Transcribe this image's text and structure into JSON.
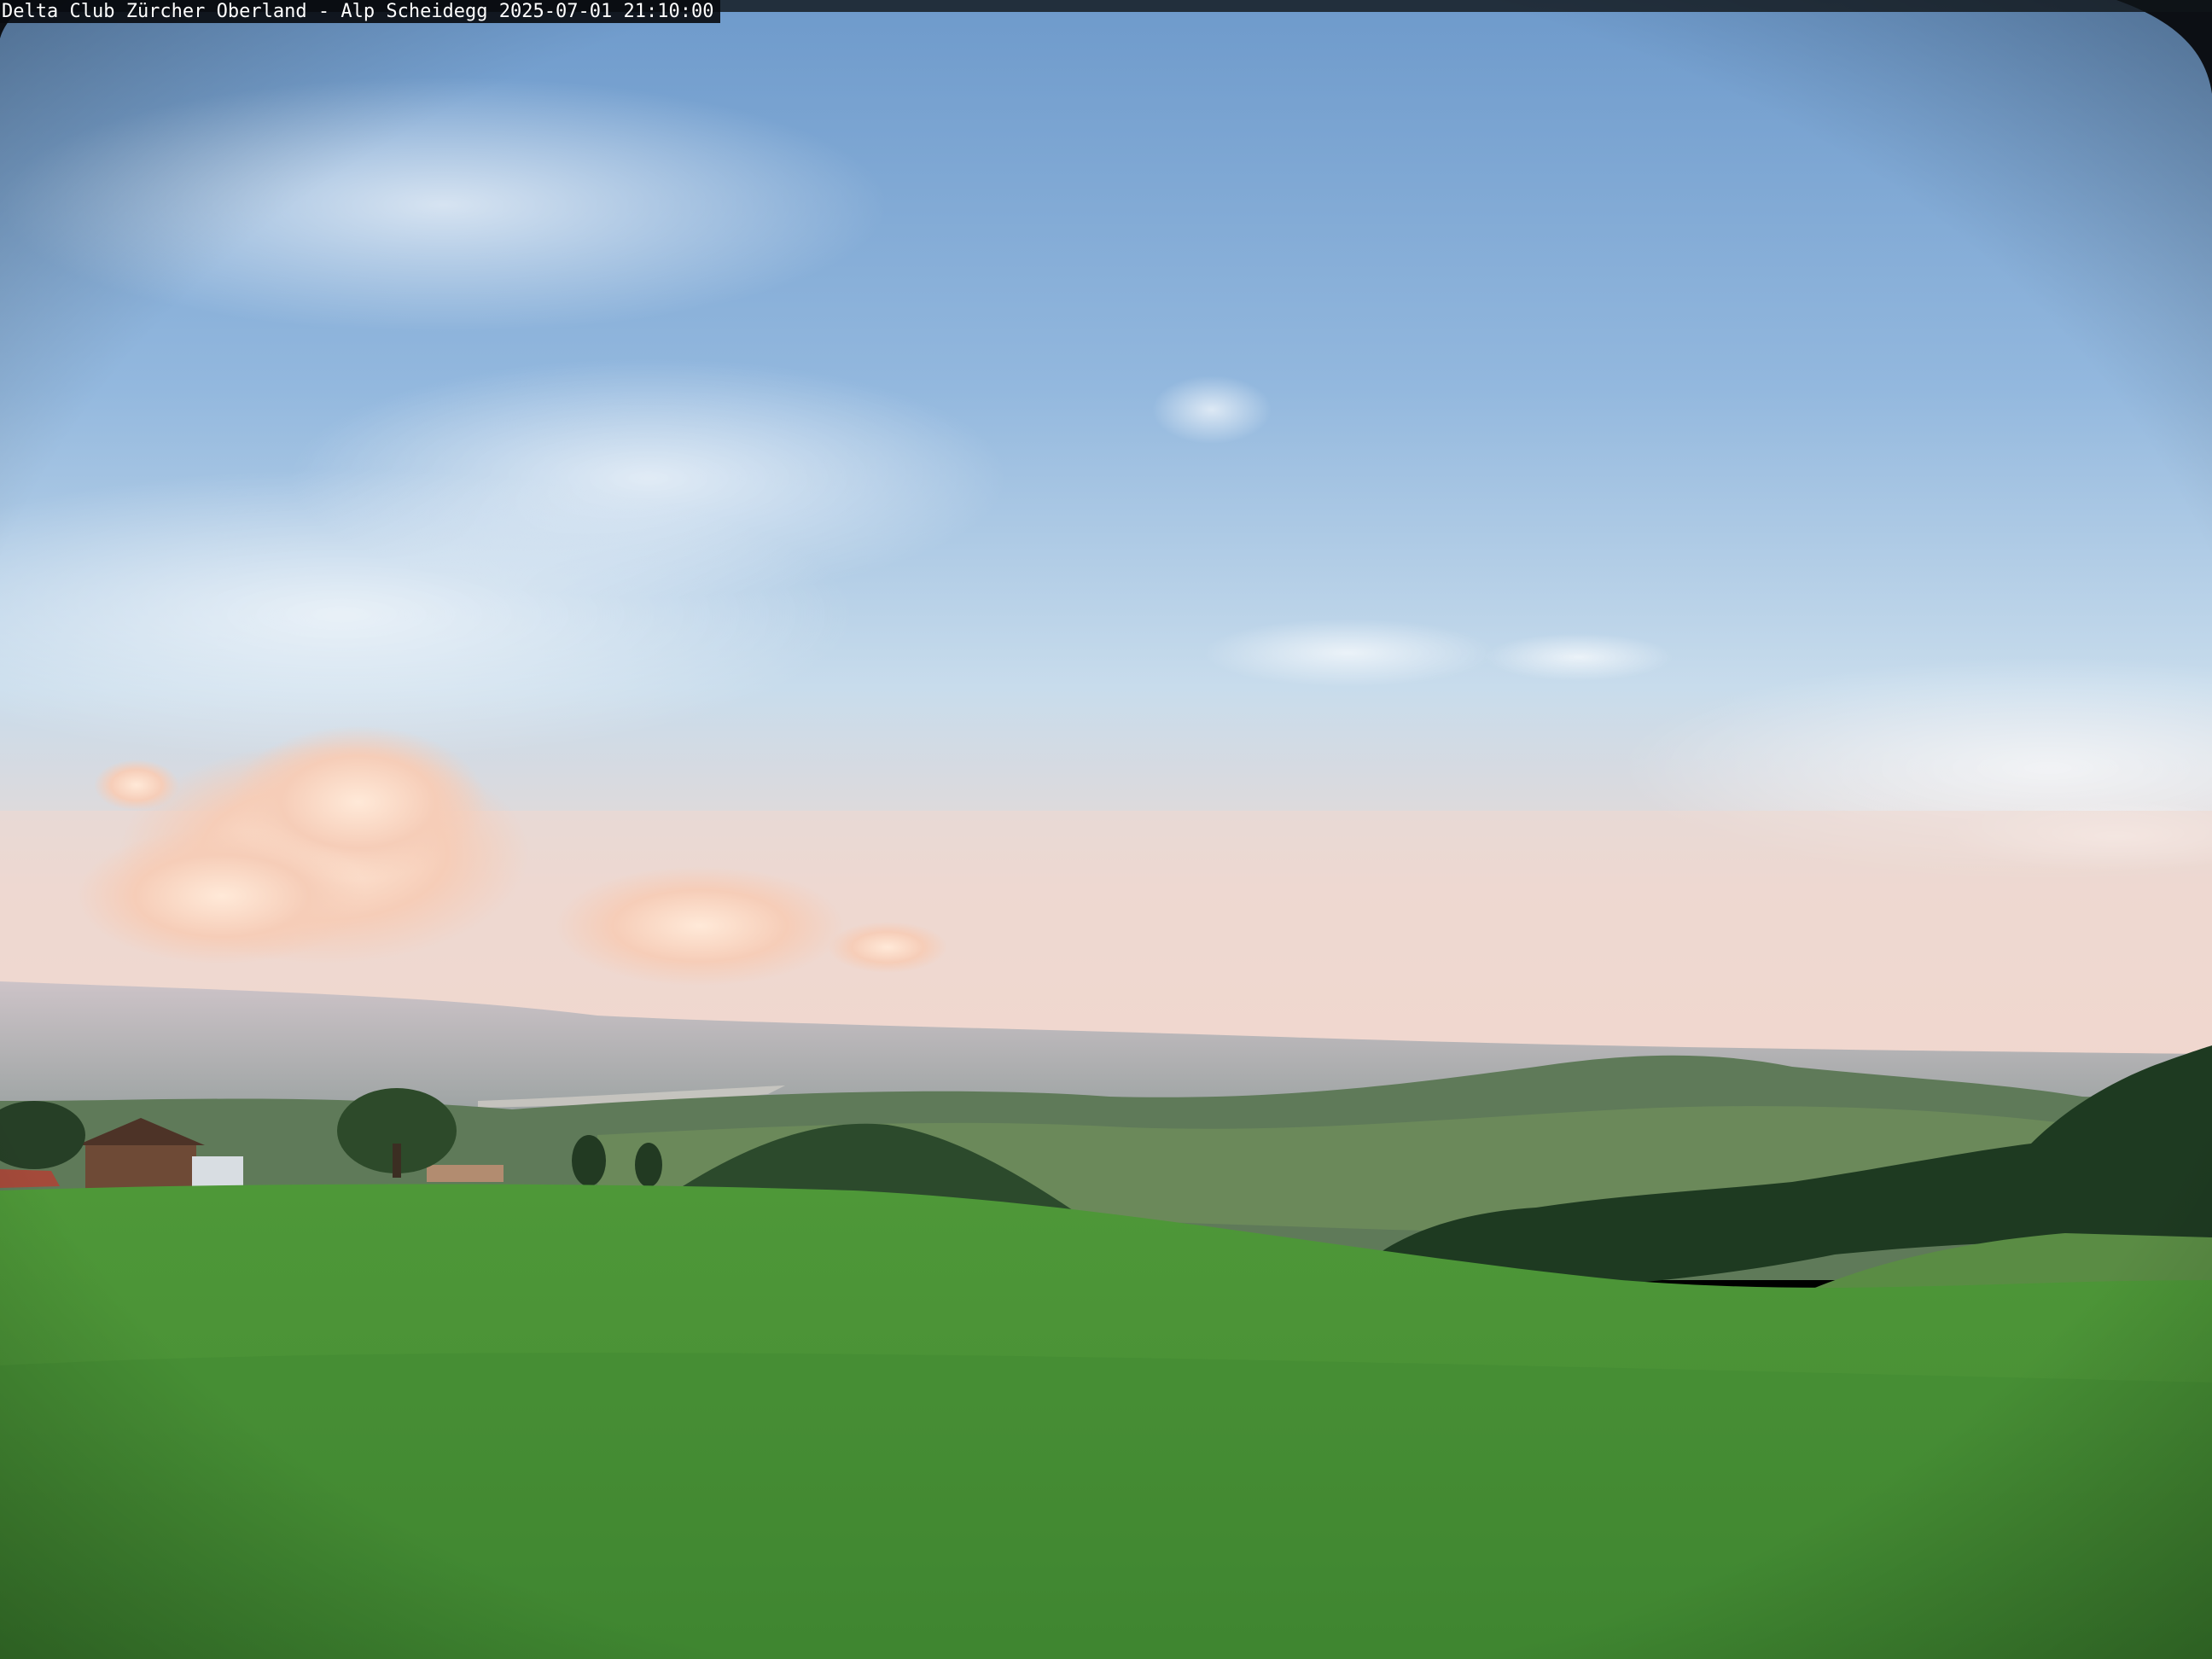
{
  "webcam": {
    "overlay_text": "Delta Club Zürcher Oberland - Alp Scheidegg 2025-07-01 21:10:00"
  },
  "scene": {
    "description_colors": {
      "sky_top": "#6f9ccd",
      "sky_mid": "#b9d3ea",
      "sky_horizon": "#f1d9cf",
      "haze": "#d9c7c4",
      "meadow": "#4f9a3c",
      "meadow_dark": "#3d822f",
      "forest": "#1f3a22",
      "hills": "#5d7657"
    }
  }
}
